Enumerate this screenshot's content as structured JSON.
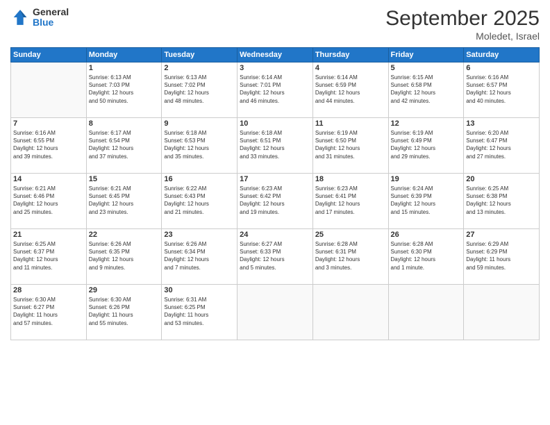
{
  "header": {
    "logo_general": "General",
    "logo_blue": "Blue",
    "month_title": "September 2025",
    "location": "Moledet, Israel"
  },
  "days_of_week": [
    "Sunday",
    "Monday",
    "Tuesday",
    "Wednesday",
    "Thursday",
    "Friday",
    "Saturday"
  ],
  "weeks": [
    [
      {
        "day": "",
        "info": ""
      },
      {
        "day": "1",
        "info": "Sunrise: 6:13 AM\nSunset: 7:03 PM\nDaylight: 12 hours\nand 50 minutes."
      },
      {
        "day": "2",
        "info": "Sunrise: 6:13 AM\nSunset: 7:02 PM\nDaylight: 12 hours\nand 48 minutes."
      },
      {
        "day": "3",
        "info": "Sunrise: 6:14 AM\nSunset: 7:01 PM\nDaylight: 12 hours\nand 46 minutes."
      },
      {
        "day": "4",
        "info": "Sunrise: 6:14 AM\nSunset: 6:59 PM\nDaylight: 12 hours\nand 44 minutes."
      },
      {
        "day": "5",
        "info": "Sunrise: 6:15 AM\nSunset: 6:58 PM\nDaylight: 12 hours\nand 42 minutes."
      },
      {
        "day": "6",
        "info": "Sunrise: 6:16 AM\nSunset: 6:57 PM\nDaylight: 12 hours\nand 40 minutes."
      }
    ],
    [
      {
        "day": "7",
        "info": "Sunrise: 6:16 AM\nSunset: 6:55 PM\nDaylight: 12 hours\nand 39 minutes."
      },
      {
        "day": "8",
        "info": "Sunrise: 6:17 AM\nSunset: 6:54 PM\nDaylight: 12 hours\nand 37 minutes."
      },
      {
        "day": "9",
        "info": "Sunrise: 6:18 AM\nSunset: 6:53 PM\nDaylight: 12 hours\nand 35 minutes."
      },
      {
        "day": "10",
        "info": "Sunrise: 6:18 AM\nSunset: 6:51 PM\nDaylight: 12 hours\nand 33 minutes."
      },
      {
        "day": "11",
        "info": "Sunrise: 6:19 AM\nSunset: 6:50 PM\nDaylight: 12 hours\nand 31 minutes."
      },
      {
        "day": "12",
        "info": "Sunrise: 6:19 AM\nSunset: 6:49 PM\nDaylight: 12 hours\nand 29 minutes."
      },
      {
        "day": "13",
        "info": "Sunrise: 6:20 AM\nSunset: 6:47 PM\nDaylight: 12 hours\nand 27 minutes."
      }
    ],
    [
      {
        "day": "14",
        "info": "Sunrise: 6:21 AM\nSunset: 6:46 PM\nDaylight: 12 hours\nand 25 minutes."
      },
      {
        "day": "15",
        "info": "Sunrise: 6:21 AM\nSunset: 6:45 PM\nDaylight: 12 hours\nand 23 minutes."
      },
      {
        "day": "16",
        "info": "Sunrise: 6:22 AM\nSunset: 6:43 PM\nDaylight: 12 hours\nand 21 minutes."
      },
      {
        "day": "17",
        "info": "Sunrise: 6:23 AM\nSunset: 6:42 PM\nDaylight: 12 hours\nand 19 minutes."
      },
      {
        "day": "18",
        "info": "Sunrise: 6:23 AM\nSunset: 6:41 PM\nDaylight: 12 hours\nand 17 minutes."
      },
      {
        "day": "19",
        "info": "Sunrise: 6:24 AM\nSunset: 6:39 PM\nDaylight: 12 hours\nand 15 minutes."
      },
      {
        "day": "20",
        "info": "Sunrise: 6:25 AM\nSunset: 6:38 PM\nDaylight: 12 hours\nand 13 minutes."
      }
    ],
    [
      {
        "day": "21",
        "info": "Sunrise: 6:25 AM\nSunset: 6:37 PM\nDaylight: 12 hours\nand 11 minutes."
      },
      {
        "day": "22",
        "info": "Sunrise: 6:26 AM\nSunset: 6:35 PM\nDaylight: 12 hours\nand 9 minutes."
      },
      {
        "day": "23",
        "info": "Sunrise: 6:26 AM\nSunset: 6:34 PM\nDaylight: 12 hours\nand 7 minutes."
      },
      {
        "day": "24",
        "info": "Sunrise: 6:27 AM\nSunset: 6:33 PM\nDaylight: 12 hours\nand 5 minutes."
      },
      {
        "day": "25",
        "info": "Sunrise: 6:28 AM\nSunset: 6:31 PM\nDaylight: 12 hours\nand 3 minutes."
      },
      {
        "day": "26",
        "info": "Sunrise: 6:28 AM\nSunset: 6:30 PM\nDaylight: 12 hours\nand 1 minute."
      },
      {
        "day": "27",
        "info": "Sunrise: 6:29 AM\nSunset: 6:29 PM\nDaylight: 11 hours\nand 59 minutes."
      }
    ],
    [
      {
        "day": "28",
        "info": "Sunrise: 6:30 AM\nSunset: 6:27 PM\nDaylight: 11 hours\nand 57 minutes."
      },
      {
        "day": "29",
        "info": "Sunrise: 6:30 AM\nSunset: 6:26 PM\nDaylight: 11 hours\nand 55 minutes."
      },
      {
        "day": "30",
        "info": "Sunrise: 6:31 AM\nSunset: 6:25 PM\nDaylight: 11 hours\nand 53 minutes."
      },
      {
        "day": "",
        "info": ""
      },
      {
        "day": "",
        "info": ""
      },
      {
        "day": "",
        "info": ""
      },
      {
        "day": "",
        "info": ""
      }
    ]
  ]
}
